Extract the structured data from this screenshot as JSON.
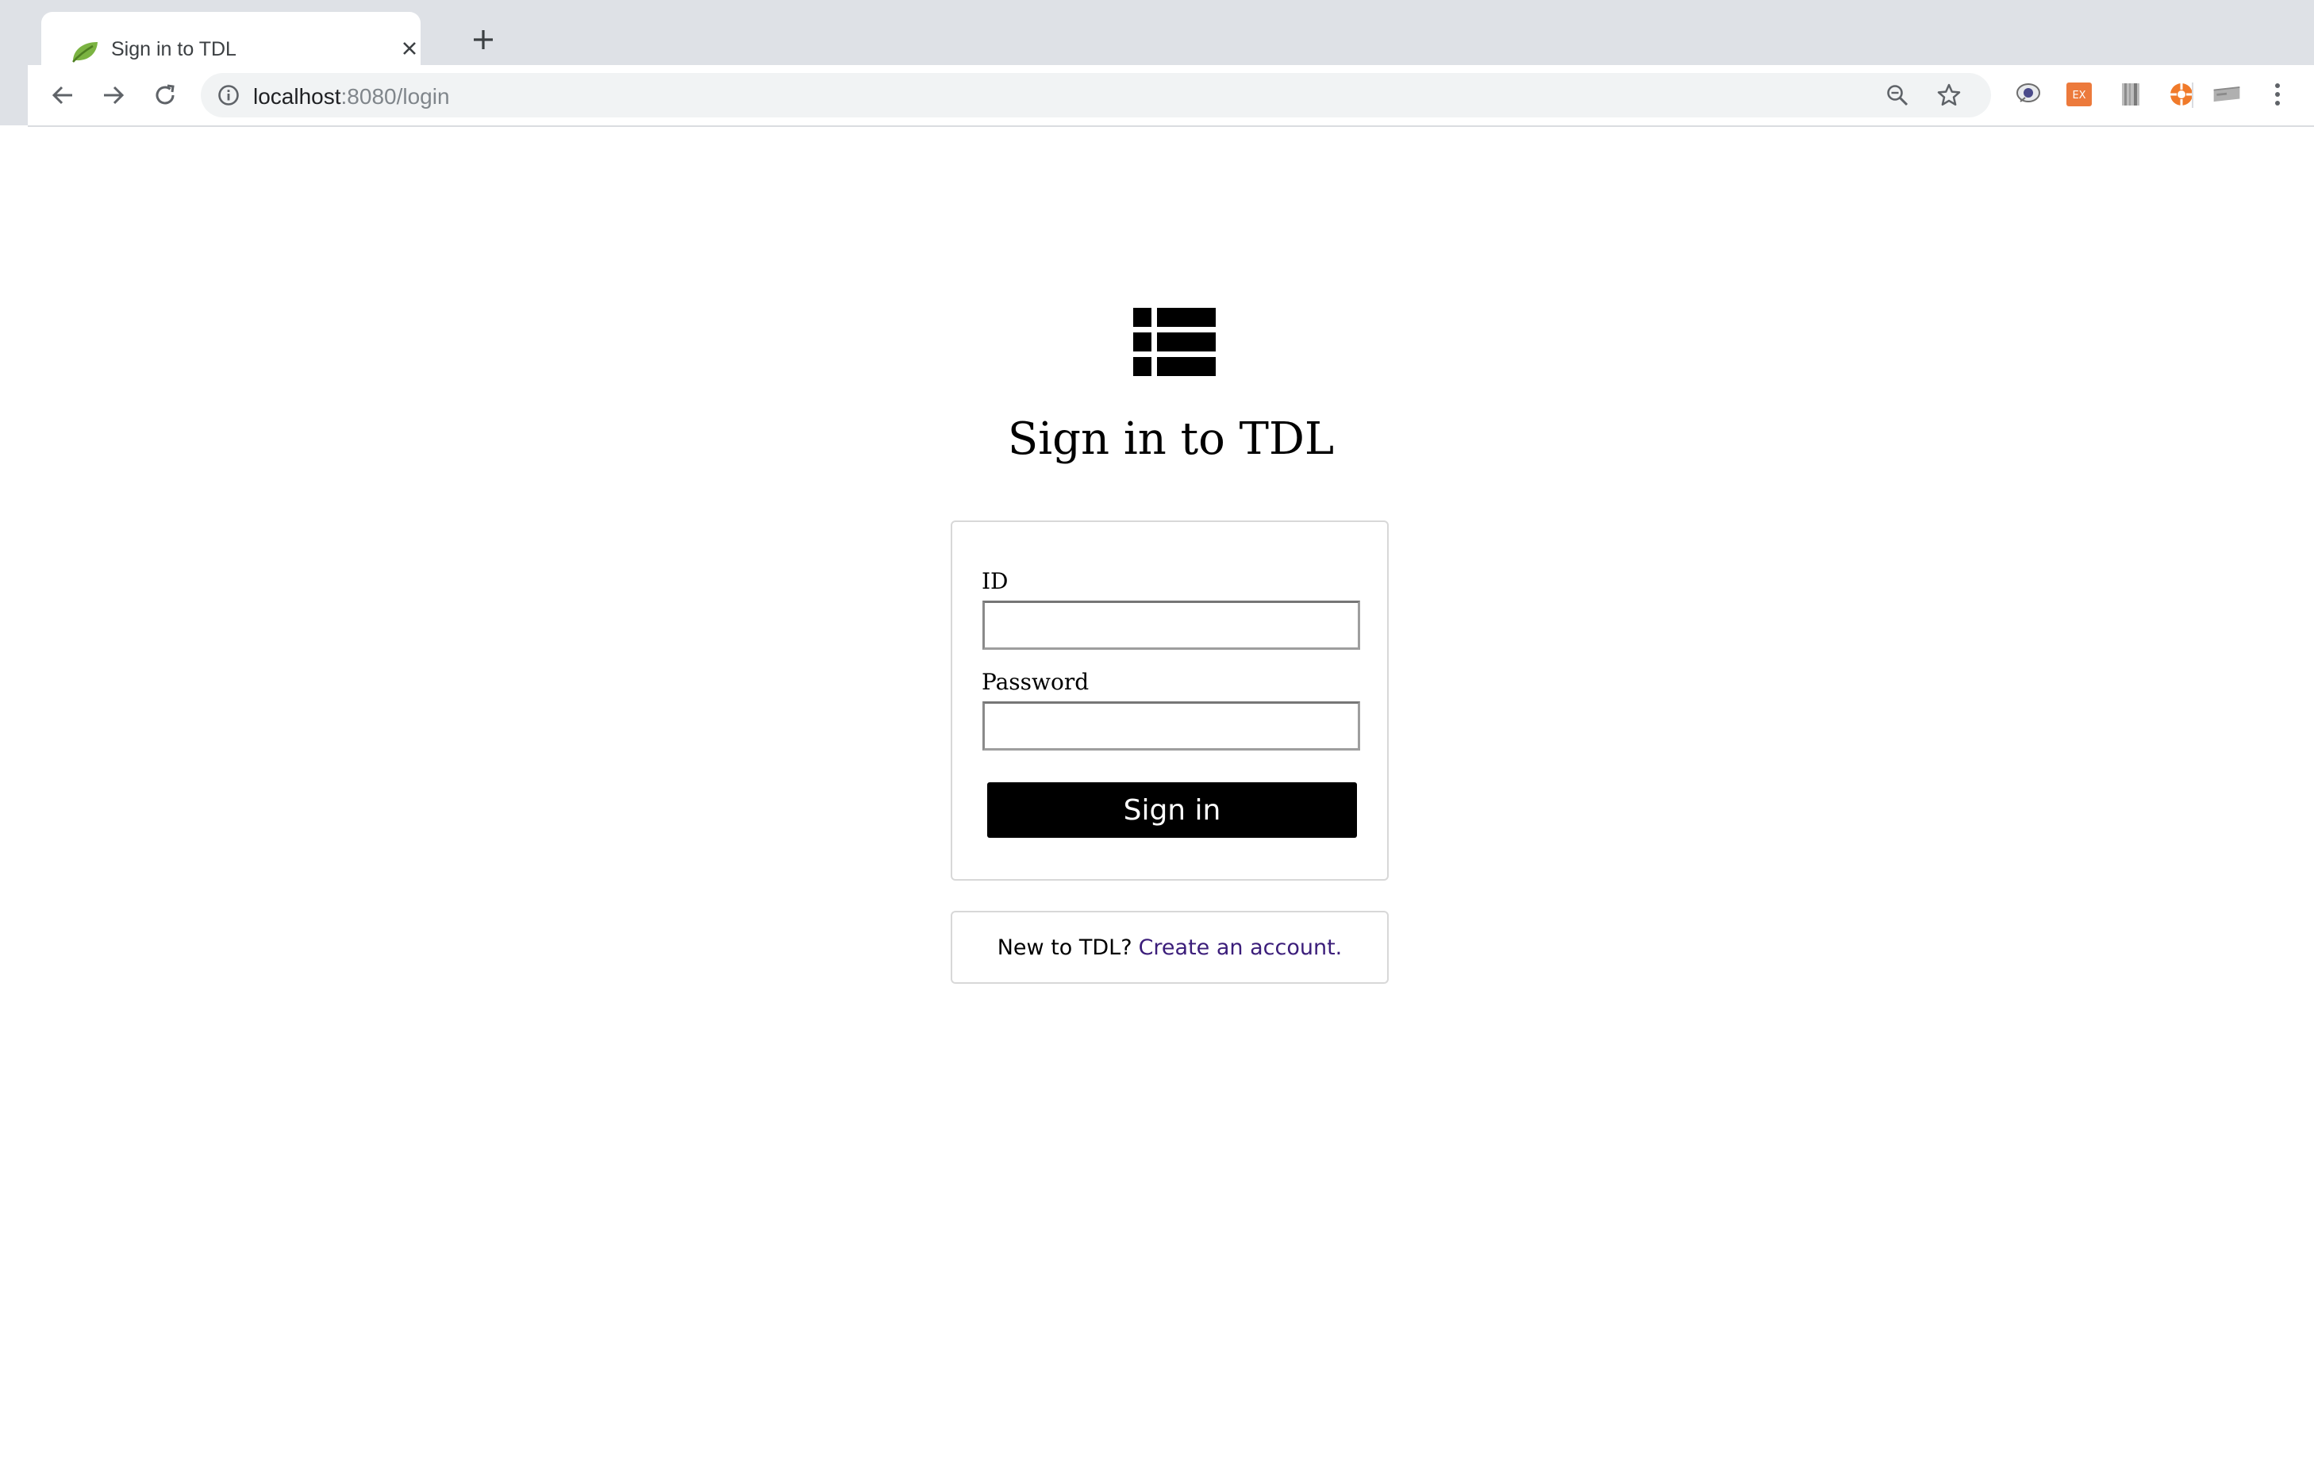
{
  "browser": {
    "tab": {
      "title": "Sign in to TDL",
      "favicon": "spring-leaf-icon"
    },
    "new_tab_icon": "plus-icon",
    "nav": {
      "back_icon": "arrow-left-icon",
      "forward_icon": "arrow-right-icon",
      "reload_icon": "reload-icon"
    },
    "omnibox": {
      "info_icon": "info-icon",
      "url_host": "localhost",
      "url_rest": ":8080/login",
      "zoom_icon": "zoom-out-icon",
      "bookmark_icon": "star-icon"
    },
    "extensions": [
      "eye-extension-icon",
      "ex-extension-icon",
      "barcode-extension-icon",
      "orange-circle-extension-icon",
      "card-extension-icon"
    ],
    "extension_ex_label": "EX",
    "menu_icon": "kebab-menu-icon"
  },
  "page": {
    "logo_icon": "table-list-icon",
    "heading": "Sign in to TDL",
    "form": {
      "id_label": "ID",
      "id_value": "",
      "password_label": "Password",
      "password_value": "",
      "submit_label": "Sign in"
    },
    "signup": {
      "prompt": "New to TDL?",
      "link": "Create an account."
    }
  },
  "colors": {
    "tabstrip_bg": "#dee1e6",
    "omnibox_bg": "#f1f3f4",
    "button_bg": "#000000",
    "link": "#3b1d7a",
    "box_border": "#d8d8d8"
  }
}
